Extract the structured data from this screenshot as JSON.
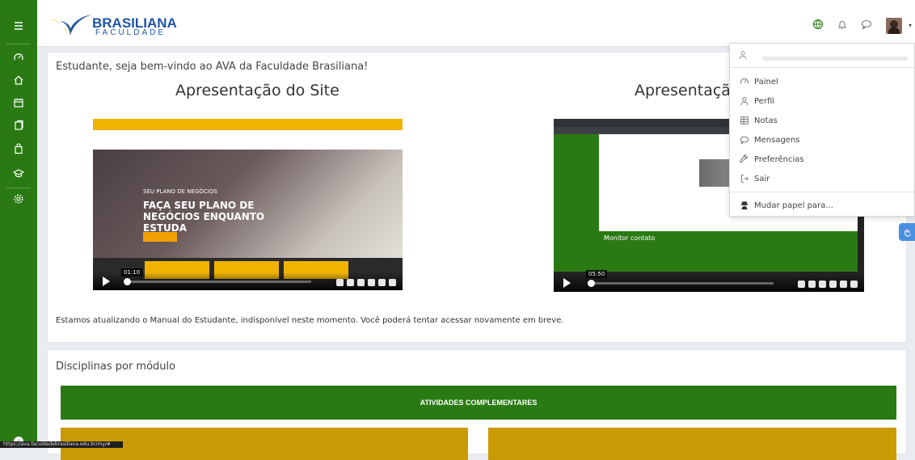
{
  "header": {
    "logo_main": "BRASILIANA",
    "logo_sub": "FACULDADE"
  },
  "sidebar": {
    "items": [
      "menu-icon",
      "gauge-icon",
      "home-icon",
      "calendar-icon",
      "files-icon",
      "bag-icon",
      "graduation-icon",
      "settings-icon"
    ]
  },
  "main": {
    "welcome": "Estudante, seja bem-vindo ao AVA da Faculdade Brasiliana!",
    "video1": {
      "title": "Apresentação do Site",
      "overlay_small": "SEU PLANO DE NEGÓCIOS",
      "overlay_big": "FAÇA SEU PLANO DE NEGÓCIOS ENQUANTO ESTUDA",
      "time": "01:10"
    },
    "video2": {
      "title": "Apresentação",
      "contact": "Monitor contato",
      "time": "05:50"
    },
    "notice": "Estamos atualizando o Manual do Estudante, indisponível neste momento. Você poderá tentar acessar novamente em breve."
  },
  "modules": {
    "title": "Disciplinas por módulo",
    "banner": "ATIVIDADES COMPLEMENTARES"
  },
  "user_menu": {
    "items": [
      {
        "label": "Painel",
        "icon": "gauge-icon"
      },
      {
        "label": "Perfil",
        "icon": "user-icon"
      },
      {
        "label": "Notas",
        "icon": "grades-icon"
      },
      {
        "label": "Mensagens",
        "icon": "chat-icon"
      },
      {
        "label": "Preferências",
        "icon": "wrench-icon"
      },
      {
        "label": "Sair",
        "icon": "logout-icon"
      }
    ],
    "switch_role": "Mudar papel para..."
  },
  "status_url": "https://ava.faculdadebrasiliana.edu.br/my/#"
}
